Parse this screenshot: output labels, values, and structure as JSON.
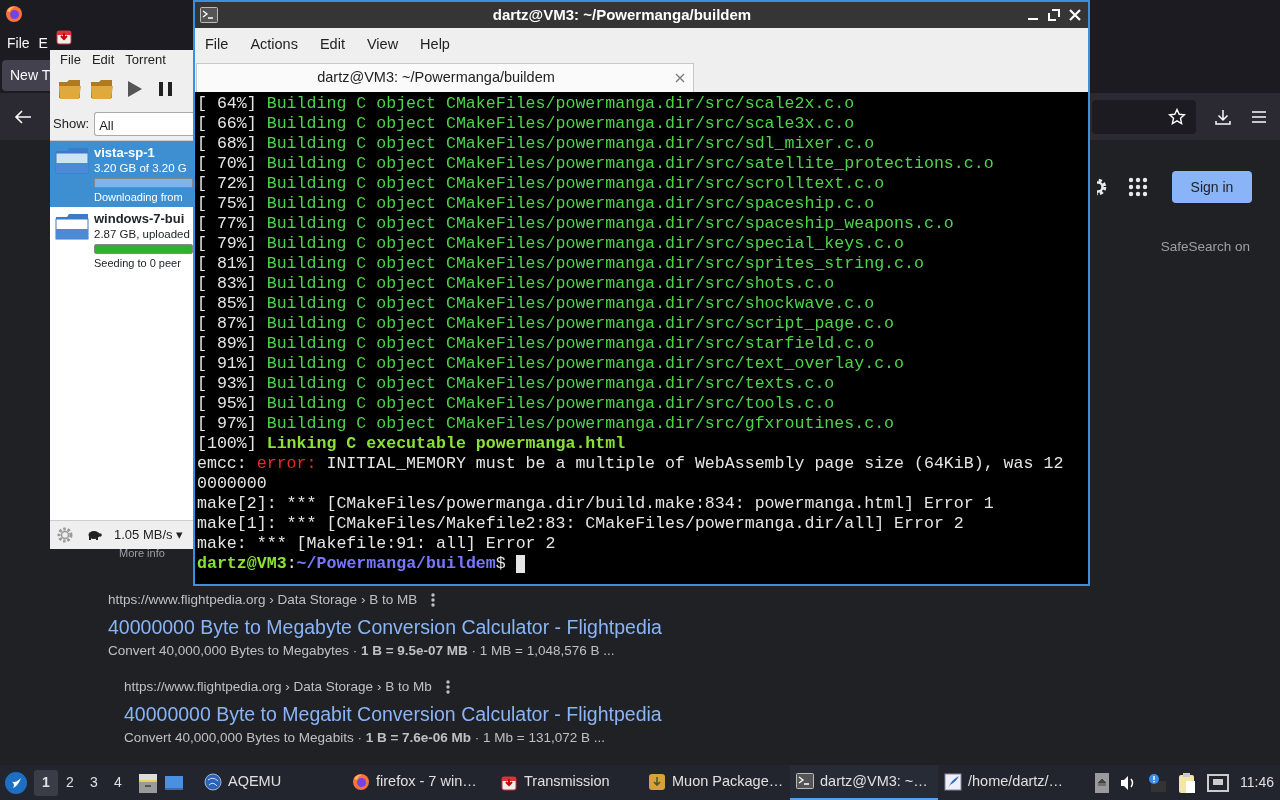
{
  "browser": {
    "menu": [
      {
        "label": "File"
      },
      {
        "label": "E"
      }
    ],
    "tab": {
      "title": "New T"
    },
    "page": {
      "sign_in": "Sign in",
      "safesearch": "SafeSearch on",
      "more_info": "More info",
      "results": [
        {
          "url": "https://www.flightpedia.org › Data Storage › B to MB",
          "title": "40000000 Byte to Megabyte Conversion Calculator - Flightpedia",
          "snippet": "Convert 40,000,000 Bytes to Megabytes · **1 B = 9.5e-07 MB** · 1 MB = 1,048,576 B ...",
          "indented": false
        },
        {
          "url": "https://www.flightpedia.org › Data Storage › B to Mb",
          "title": "40000000 Byte to Megabit Conversion Calculator - Flightpedia",
          "snippet": "Convert 40,000,000 Bytes to Megabits · **1 B = 7.6e-06 Mb** · 1 Mb = 131,072 B ...",
          "indented": true
        }
      ]
    }
  },
  "transmission": {
    "menu": [
      {
        "label": "File"
      },
      {
        "label": "Edit"
      },
      {
        "label": "Torrent"
      }
    ],
    "show_label": "Show:",
    "filter": "All",
    "torrents": [
      {
        "name": "vista-sp-1",
        "size": "3.20 GB of 3.20 G",
        "status": "Downloading from",
        "level": 1,
        "kind": "downloading",
        "selected": true
      },
      {
        "name": "windows-7-bui",
        "size": "2.87 GB, uploaded",
        "status": "Seeding to 0 peer",
        "level": 1,
        "kind": "seeding",
        "selected": false
      }
    ],
    "speed": "1.05 MB/s ▾"
  },
  "terminal": {
    "title": "dartz@VM3: ~/Powermanga/buildem",
    "menu": [
      {
        "label": "File"
      },
      {
        "label": "Actions"
      },
      {
        "label": "Edit"
      },
      {
        "label": "View"
      },
      {
        "label": "Help"
      }
    ],
    "tab": {
      "title": "dartz@VM3: ~/Powermanga/buildem"
    },
    "cursor": true,
    "lines": [
      {
        "segments": [
          {
            "text": "[ 64%]",
            "kind": "plain"
          },
          {
            "text": " Building C object CMakeFiles/powermanga.dir/src/scale2x.c.o",
            "kind": "build"
          }
        ]
      },
      {
        "segments": [
          {
            "text": "[ 66%]",
            "kind": "plain"
          },
          {
            "text": " Building C object CMakeFiles/powermanga.dir/src/scale3x.c.o",
            "kind": "build"
          }
        ]
      },
      {
        "segments": [
          {
            "text": "[ 68%]",
            "kind": "plain"
          },
          {
            "text": " Building C object CMakeFiles/powermanga.dir/src/sdl_mixer.c.o",
            "kind": "build"
          }
        ]
      },
      {
        "segments": [
          {
            "text": "[ 70%]",
            "kind": "plain"
          },
          {
            "text": " Building C object CMakeFiles/powermanga.dir/src/satellite_protections.c.o",
            "kind": "build"
          }
        ]
      },
      {
        "segments": [
          {
            "text": "[ 72%]",
            "kind": "plain"
          },
          {
            "text": " Building C object CMakeFiles/powermanga.dir/src/scrolltext.c.o",
            "kind": "build"
          }
        ]
      },
      {
        "segments": [
          {
            "text": "[ 75%]",
            "kind": "plain"
          },
          {
            "text": " Building C object CMakeFiles/powermanga.dir/src/spaceship.c.o",
            "kind": "build"
          }
        ]
      },
      {
        "segments": [
          {
            "text": "[ 77%]",
            "kind": "plain"
          },
          {
            "text": " Building C object CMakeFiles/powermanga.dir/src/spaceship_weapons.c.o",
            "kind": "build"
          }
        ]
      },
      {
        "segments": [
          {
            "text": "[ 79%]",
            "kind": "plain"
          },
          {
            "text": " Building C object CMakeFiles/powermanga.dir/src/special_keys.c.o",
            "kind": "build"
          }
        ]
      },
      {
        "segments": [
          {
            "text": "[ 81%]",
            "kind": "plain"
          },
          {
            "text": " Building C object CMakeFiles/powermanga.dir/src/sprites_string.c.o",
            "kind": "build"
          }
        ]
      },
      {
        "segments": [
          {
            "text": "[ 83%]",
            "kind": "plain"
          },
          {
            "text": " Building C object CMakeFiles/powermanga.dir/src/shots.c.o",
            "kind": "build"
          }
        ]
      },
      {
        "segments": [
          {
            "text": "[ 85%]",
            "kind": "plain"
          },
          {
            "text": " Building C object CMakeFiles/powermanga.dir/src/shockwave.c.o",
            "kind": "build"
          }
        ]
      },
      {
        "segments": [
          {
            "text": "[ 87%]",
            "kind": "plain"
          },
          {
            "text": " Building C object CMakeFiles/powermanga.dir/src/script_page.c.o",
            "kind": "build"
          }
        ]
      },
      {
        "segments": [
          {
            "text": "[ 89%]",
            "kind": "plain"
          },
          {
            "text": " Building C object CMakeFiles/powermanga.dir/src/starfield.c.o",
            "kind": "build"
          }
        ]
      },
      {
        "segments": [
          {
            "text": "[ 91%]",
            "kind": "plain"
          },
          {
            "text": " Building C object CMakeFiles/powermanga.dir/src/text_overlay.c.o",
            "kind": "build"
          }
        ]
      },
      {
        "segments": [
          {
            "text": "[ 93%]",
            "kind": "plain"
          },
          {
            "text": " Building C object CMakeFiles/powermanga.dir/src/texts.c.o",
            "kind": "build"
          }
        ]
      },
      {
        "segments": [
          {
            "text": "[ 95%]",
            "kind": "plain"
          },
          {
            "text": " Building C object CMakeFiles/powermanga.dir/src/tools.c.o",
            "kind": "build"
          }
        ]
      },
      {
        "segments": [
          {
            "text": "[ 97%]",
            "kind": "plain"
          },
          {
            "text": " Building C object CMakeFiles/powermanga.dir/src/gfxroutines.c.o",
            "kind": "build"
          }
        ]
      },
      {
        "segments": [
          {
            "text": "[100%]",
            "kind": "plain"
          },
          {
            "text": " Linking C executable powermanga.html",
            "kind": "link"
          }
        ]
      },
      {
        "segments": [
          {
            "text": "emcc: ",
            "kind": "plain"
          },
          {
            "text": "error:",
            "kind": "error"
          },
          {
            "text": " INITIAL_MEMORY must be a multiple of WebAssembly page size (64KiB), was 12",
            "kind": "plain"
          }
        ]
      },
      {
        "segments": [
          {
            "text": "0000000",
            "kind": "plain"
          }
        ]
      },
      {
        "segments": [
          {
            "text": "make[2]: *** [CMakeFiles/powermanga.dir/build.make:834: powermanga.html] Error 1",
            "kind": "plain"
          }
        ]
      },
      {
        "segments": [
          {
            "text": "make[1]: *** [CMakeFiles/Makefile2:83: CMakeFiles/powermanga.dir/all] Error 2",
            "kind": "plain"
          }
        ]
      },
      {
        "segments": [
          {
            "text": "make: *** [Makefile:91: all] Error 2",
            "kind": "plain"
          }
        ]
      },
      {
        "segments": [
          {
            "text": "dartz@VM3",
            "kind": "user"
          },
          {
            "text": ":",
            "kind": "plain"
          },
          {
            "text": "~/Powermanga/buildem",
            "kind": "path"
          },
          {
            "text": "$ ",
            "kind": "plain"
          }
        ]
      }
    ]
  },
  "taskbar": {
    "workspaces": [
      {
        "label": "1",
        "selected": true
      },
      {
        "label": "2",
        "selected": false
      },
      {
        "label": "3",
        "selected": false
      },
      {
        "label": "4",
        "selected": false
      }
    ],
    "tasks": [
      {
        "label": "AQEMU",
        "kind": "aqemu",
        "selected": false
      },
      {
        "label": "firefox - 7 win…",
        "kind": "firefox",
        "selected": false
      },
      {
        "label": "Transmission",
        "kind": "transmission",
        "selected": false
      },
      {
        "label": "Muon Package…",
        "kind": "muon",
        "selected": false
      },
      {
        "label": "dartz@VM3: ~…",
        "kind": "terminal",
        "selected": true
      },
      {
        "label": "/home/dartz/…",
        "kind": "editor",
        "selected": false
      }
    ],
    "clock": "11:46"
  }
}
